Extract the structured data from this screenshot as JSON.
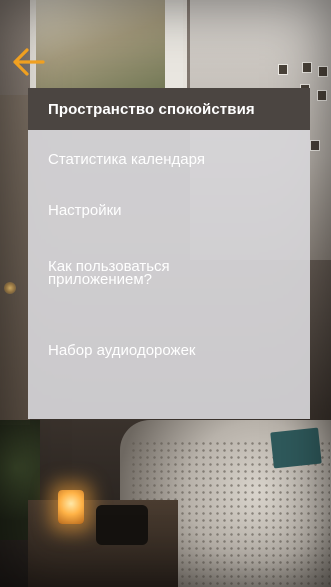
{
  "header": {
    "back_icon": "arrow-left-icon",
    "accent_color": "#f0a020"
  },
  "menu": {
    "title": "Пространство спокойствия",
    "items": [
      {
        "label": "Статистика календаря"
      },
      {
        "label": "Настройки"
      },
      {
        "label": "Как пользоваться приложением?"
      },
      {
        "label": "Набор аудиодорожек"
      }
    ]
  }
}
